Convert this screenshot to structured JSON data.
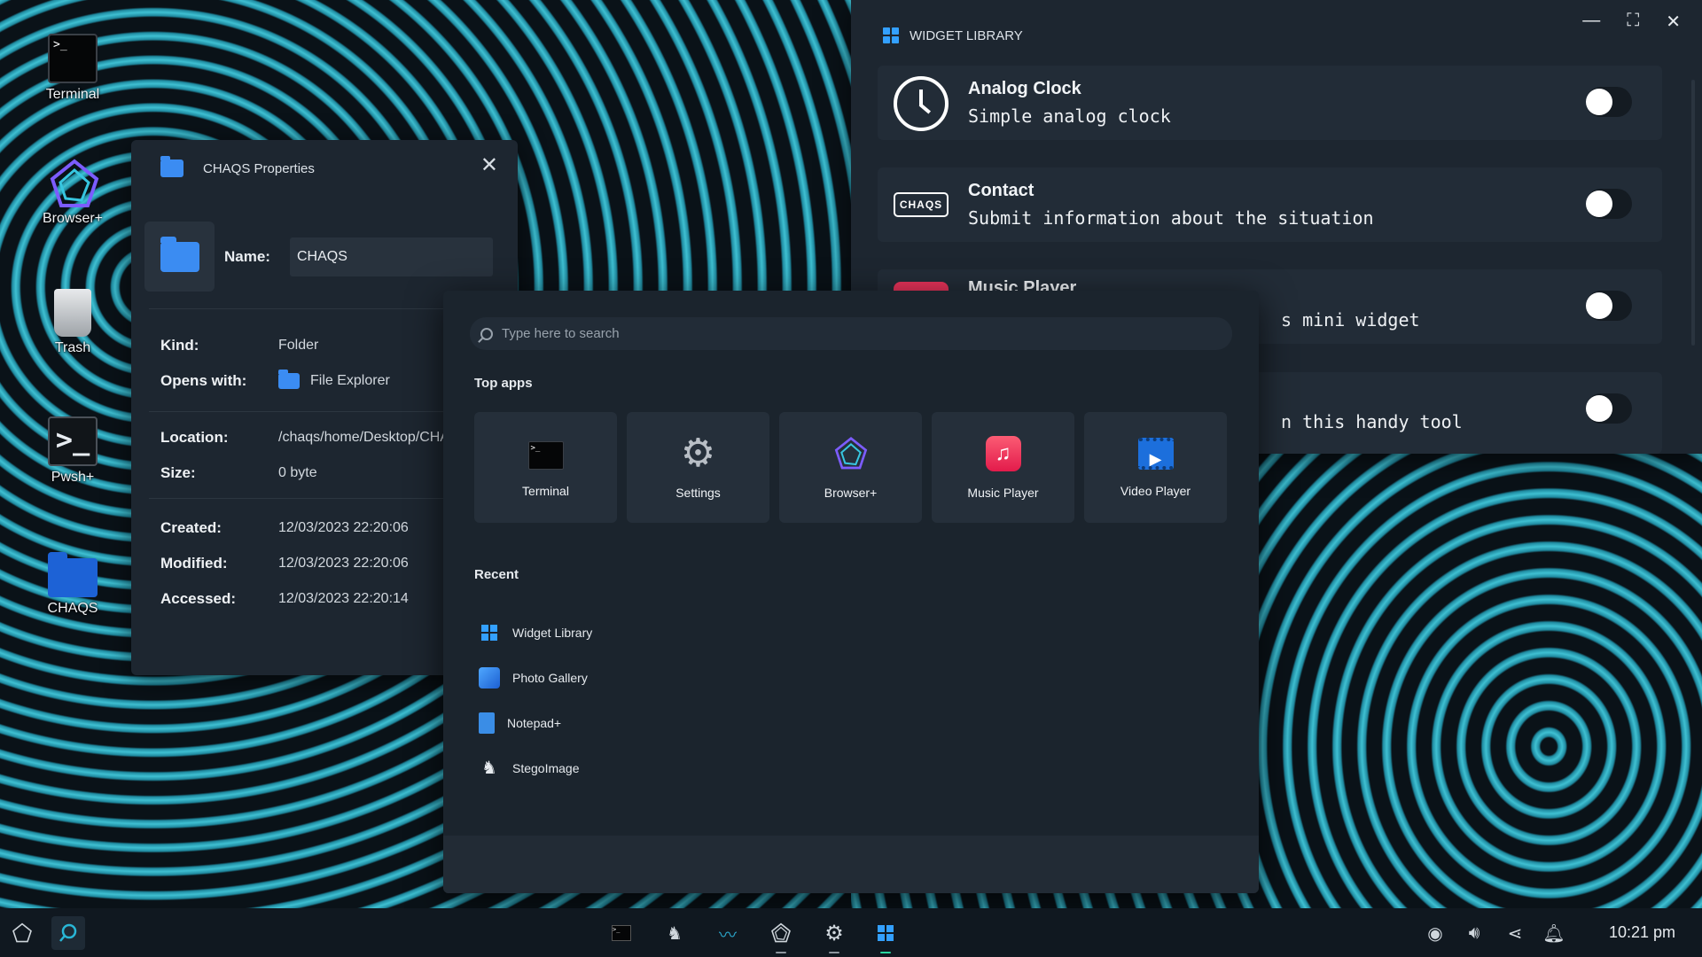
{
  "desktop": {
    "icons": [
      {
        "label": "Terminal",
        "icon": "terminal-icon"
      },
      {
        "label": "Browser+",
        "icon": "browser-icon"
      },
      {
        "label": "Trash",
        "icon": "trash-icon"
      },
      {
        "label": "Pwsh+",
        "icon": "pwsh-icon"
      },
      {
        "label": "CHAQS",
        "icon": "folder-icon"
      }
    ]
  },
  "properties": {
    "title": "CHAQS Properties",
    "close": "✕",
    "name_label": "Name:",
    "name_value": "CHAQS",
    "kind_label": "Kind:",
    "kind_value": "Folder",
    "opens_label": "Opens with:",
    "opens_value": "File Explorer",
    "location_label": "Location:",
    "location_value": "/chaqs/home/Desktop/CHAQS",
    "size_label": "Size:",
    "size_value": "0 byte",
    "created_label": "Created:",
    "created_value": "12/03/2023 22:20:06",
    "modified_label": "Modified:",
    "modified_value": "12/03/2023 22:20:06",
    "accessed_label": "Accessed:",
    "accessed_value": "12/03/2023 22:20:14"
  },
  "widget_library": {
    "title": "WIDGET LIBRARY",
    "controls": {
      "minimize": "—",
      "maximize": "⛶",
      "close": "✕"
    },
    "items": [
      {
        "name": "Analog Clock",
        "desc": "Simple analog clock",
        "enabled": false
      },
      {
        "name": "Contact",
        "desc": "Submit information about the situation",
        "enabled": false
      },
      {
        "name": "Music Player",
        "desc": "s mini widget",
        "enabled": false
      },
      {
        "name": "",
        "desc": "n this handy tool",
        "enabled": false
      }
    ]
  },
  "start_menu": {
    "search_placeholder": "Type here to search",
    "top_apps_label": "Top apps",
    "top_apps": [
      {
        "label": "Terminal",
        "icon": "terminal-icon"
      },
      {
        "label": "Settings",
        "icon": "gear-icon"
      },
      {
        "label": "Browser+",
        "icon": "browser-icon"
      },
      {
        "label": "Music Player",
        "icon": "music-icon"
      },
      {
        "label": "Video Player",
        "icon": "video-icon"
      }
    ],
    "recent_label": "Recent",
    "recent": [
      {
        "label": "Widget Library",
        "icon": "widget-icon"
      },
      {
        "label": "Photo Gallery",
        "icon": "photo-icon"
      },
      {
        "label": "Notepad+",
        "icon": "notepad-icon"
      },
      {
        "label": "StegoImage",
        "icon": "stego-icon"
      }
    ]
  },
  "taskbar": {
    "clock": "10:21 pm",
    "accent": "#29d6a0"
  }
}
